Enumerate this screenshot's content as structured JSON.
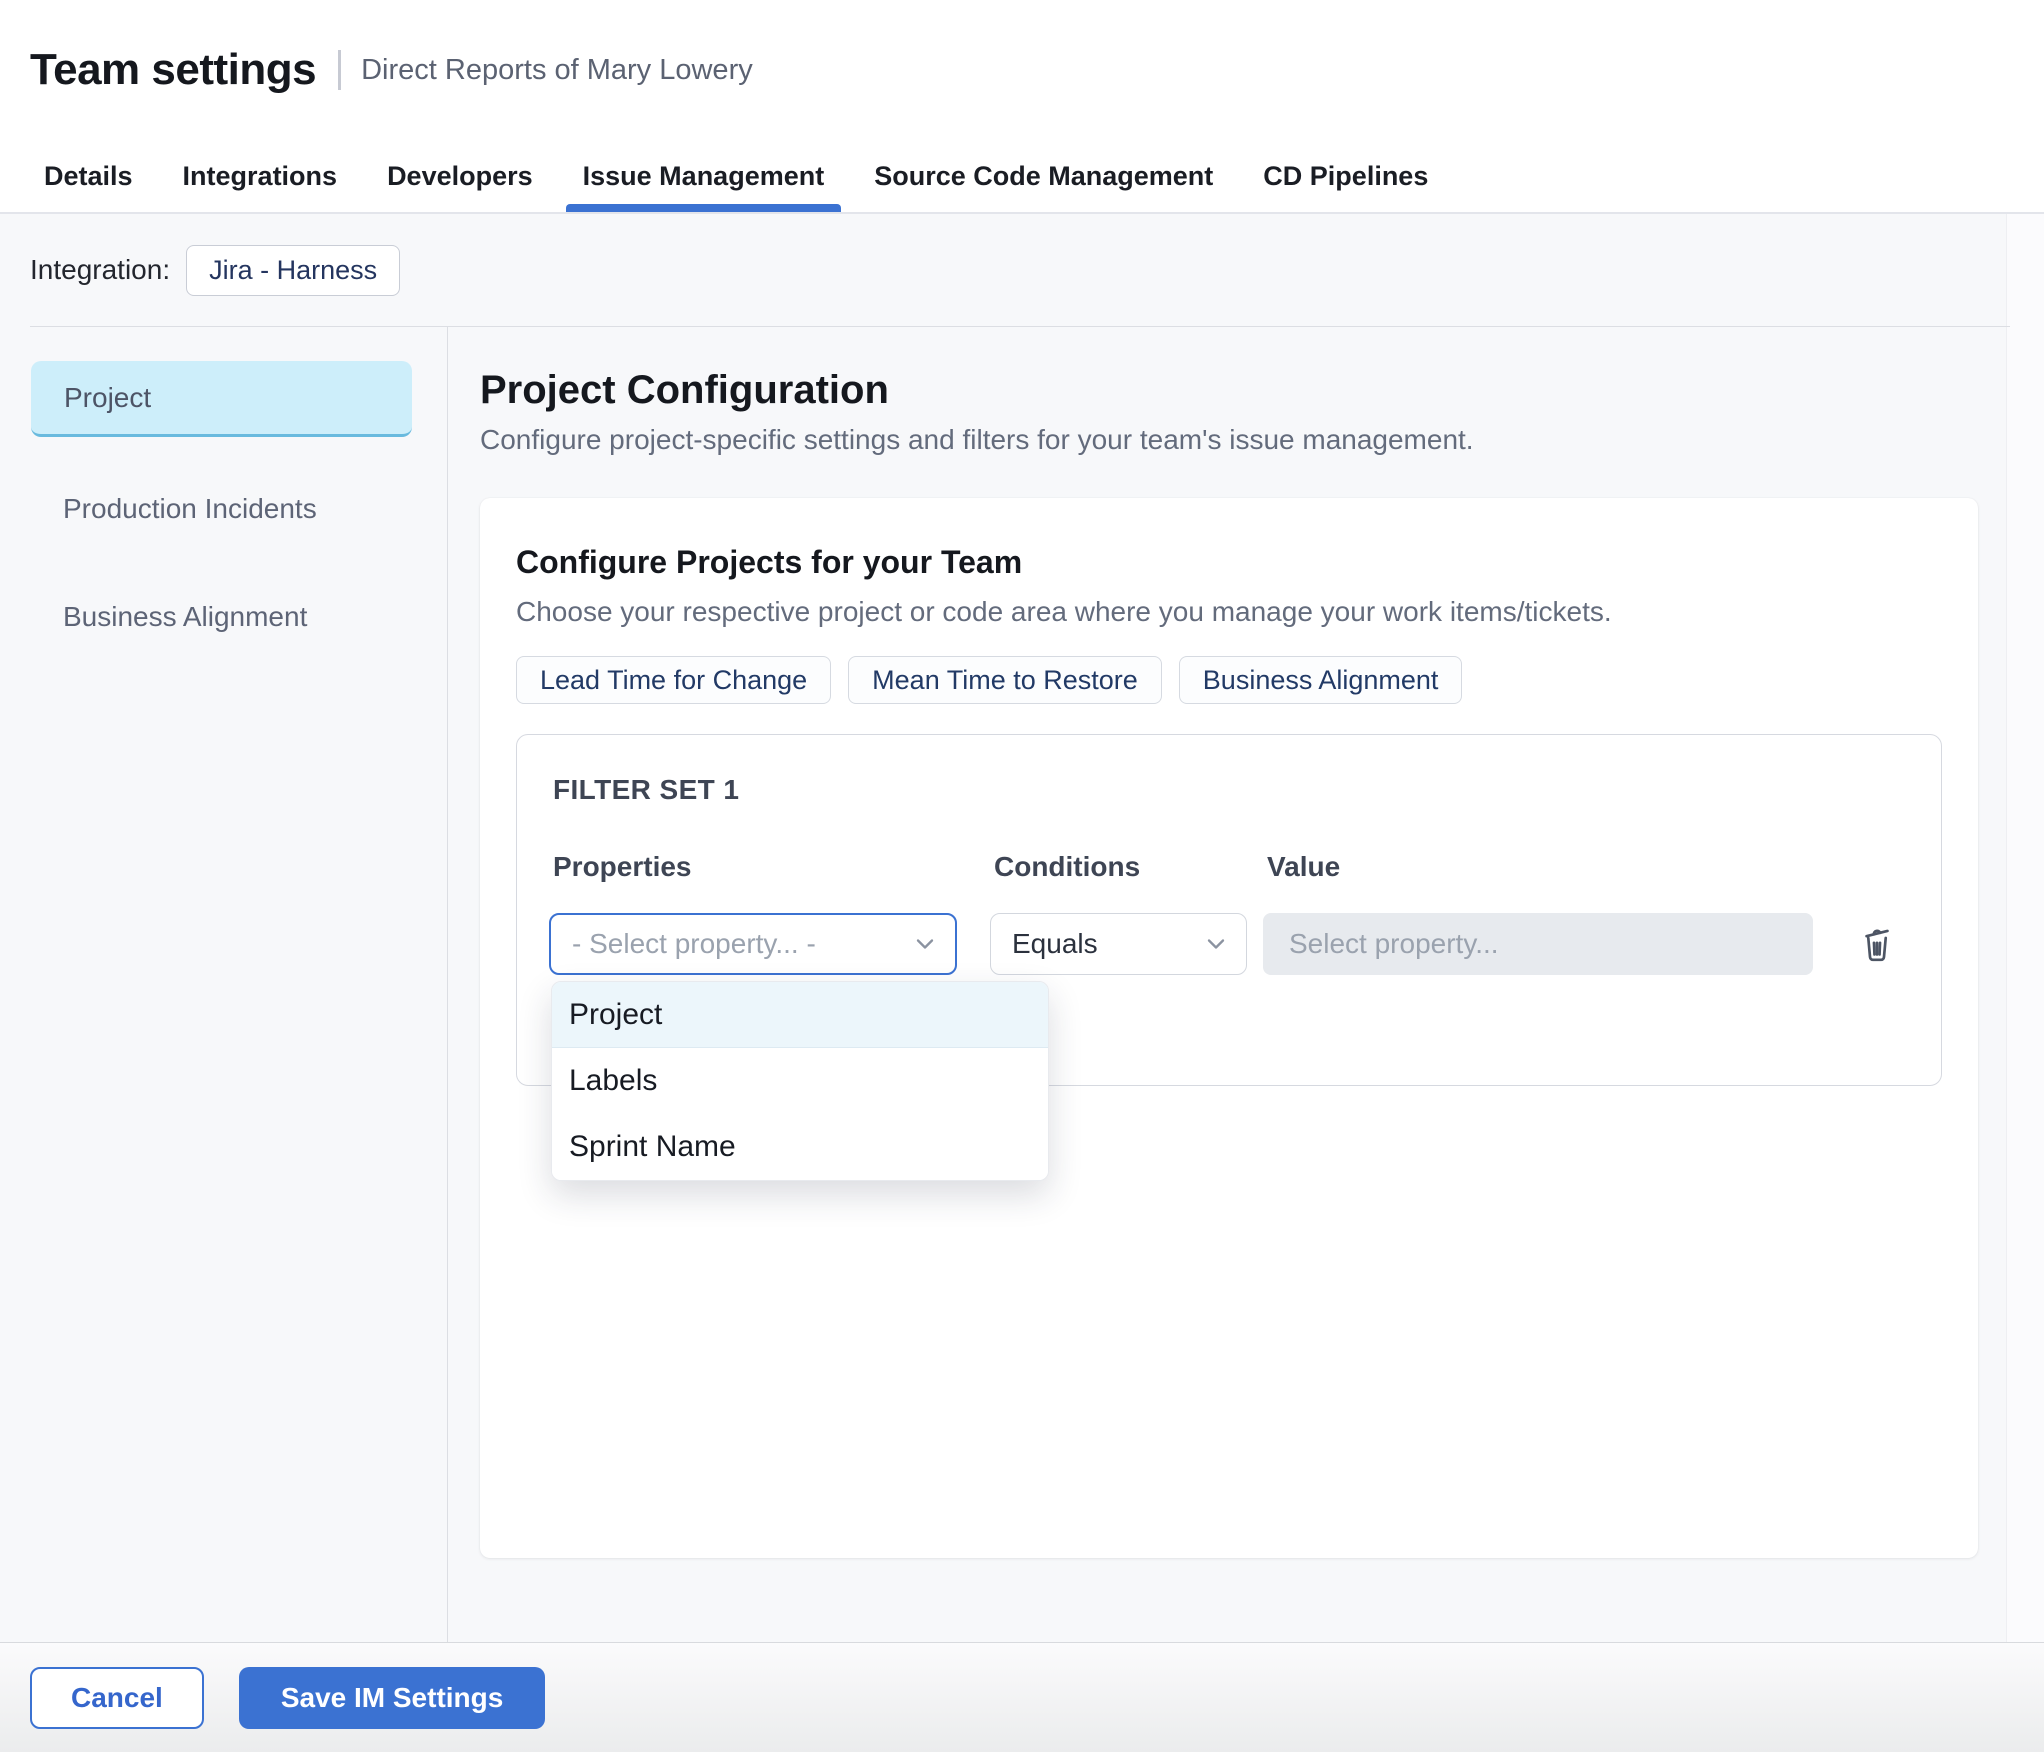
{
  "header": {
    "title": "Team settings",
    "subtitle": "Direct Reports of Mary Lowery"
  },
  "tabs": [
    {
      "label": "Details",
      "active": false
    },
    {
      "label": "Integrations",
      "active": false
    },
    {
      "label": "Developers",
      "active": false
    },
    {
      "label": "Issue Management",
      "active": true
    },
    {
      "label": "Source Code Management",
      "active": false
    },
    {
      "label": "CD Pipelines",
      "active": false
    }
  ],
  "integration": {
    "label": "Integration:",
    "chip": "Jira - Harness"
  },
  "sidebar": {
    "items": [
      {
        "label": "Project",
        "selected": true
      },
      {
        "label": "Production Incidents",
        "selected": false
      },
      {
        "label": "Business Alignment",
        "selected": false
      }
    ]
  },
  "main": {
    "title": "Project Configuration",
    "description": "Configure project-specific settings and filters for your team's issue management.",
    "card": {
      "heading": "Configure Projects for your Team",
      "description": "Choose your respective project or code area where you manage your work items/tickets.",
      "chips": [
        {
          "label": "Lead Time for Change"
        },
        {
          "label": "Mean Time to Restore"
        },
        {
          "label": "Business Alignment"
        }
      ],
      "filter_set": {
        "title": "FILTER SET 1",
        "columns": {
          "properties": "Properties",
          "conditions": "Conditions",
          "value": "Value"
        },
        "properties_placeholder": "- Select property... -",
        "condition_selected": "Equals",
        "value_placeholder": "Select property...",
        "dropdown": {
          "items": [
            {
              "label": "Project",
              "highlighted": true
            },
            {
              "label": "Labels",
              "highlighted": false
            },
            {
              "label": "Sprint Name",
              "highlighted": false
            }
          ]
        }
      }
    }
  },
  "footer": {
    "cancel_label": "Cancel",
    "save_label": "Save IM Settings"
  },
  "colors": {
    "accent": "#3b72d2",
    "content_bg": "#f7f8fa",
    "sidebar_selected_bg": "#cdeefa",
    "sidebar_selected_border": "#69bade",
    "dropdown_highlight": "#ecf6fb",
    "chip_text": "#223a66",
    "muted_text": "#636b7c",
    "value_input_bg": "#e7eaee"
  }
}
